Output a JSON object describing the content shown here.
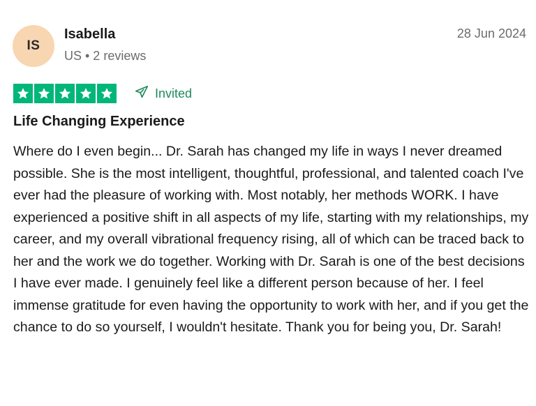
{
  "reviewer": {
    "initials": "IS",
    "name": "Isabella",
    "meta": "US • 2 reviews",
    "avatar_color": "#f8d6b1"
  },
  "review": {
    "date": "28 Jun 2024",
    "rating": 5,
    "rating_max": 5,
    "star_color": "#00b67a",
    "invited_icon": "send-icon",
    "invited_label": "Invited",
    "title": "Life Changing Experience",
    "body": "Where do I even begin... Dr. Sarah has changed my life in ways I never dreamed possible. She is the most intelligent, thoughtful, professional, and talented coach I've ever had the pleasure of working with. Most notably, her methods WORK. I have experienced a positive shift in all aspects of my life, starting with my relationships, my career, and my overall vibrational frequency rising, all of which can be traced back to her and the work we do together. Working with Dr. Sarah is one of the best decisions I have ever made. I genuinely feel like a different person because of her. I feel immense gratitude for even having the opportunity to work with her, and if you get the chance to do so yourself, I wouldn't hesitate. Thank you for being you, Dr. Sarah!"
  }
}
